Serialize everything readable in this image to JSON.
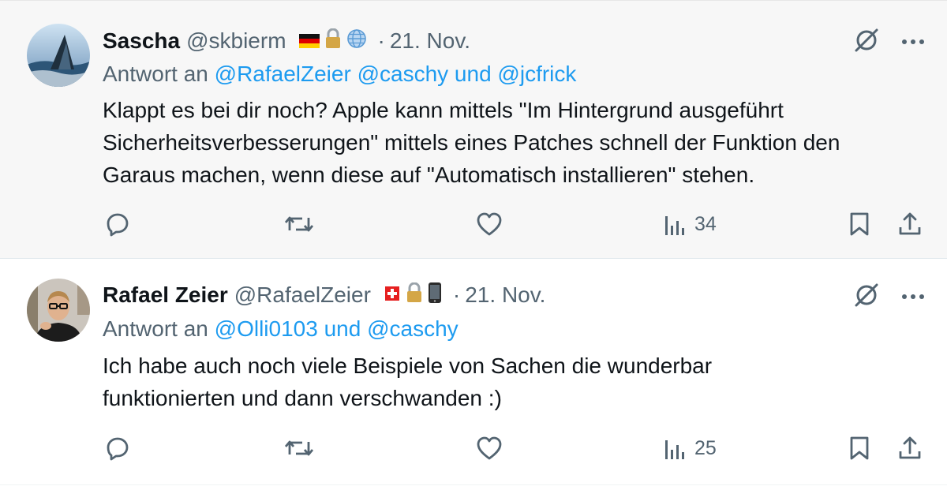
{
  "colors": {
    "link": "#1d9bf0",
    "secondary_text": "#536471",
    "primary_text": "#0f1419",
    "highlight_bg": "#f7f7f7"
  },
  "tweets": [
    {
      "name": "Sascha",
      "handle": "@skbierm",
      "badges": [
        "german-flag-icon",
        "lock-icon",
        "globe-icon"
      ],
      "separator": "·",
      "date": "21. Nov.",
      "reply_prefix": "Antwort an",
      "reply_mentions": "@RafaelZeier @caschy und @jcfrick",
      "body_lines": [
        "Klappt es bei dir noch? Apple kann mittels \"Im Hintergrund ausgeführt",
        "Sicherheitsverbesserungen\" mittels eines Patches schnell der Funktion den",
        "Garaus machen, wenn diese auf \"Automatisch installieren\" stehen."
      ],
      "views": "34"
    },
    {
      "name": "Rafael Zeier",
      "handle": "@RafaelZeier",
      "badges": [
        "swiss-flag-icon",
        "lock-icon",
        "mobile-phone-icon"
      ],
      "separator": "·",
      "date": "21. Nov.",
      "reply_prefix": "Antwort an",
      "reply_mentions": "@Olli0103 und @caschy",
      "body_lines": [
        "Ich habe auch noch viele Beispiele von Sachen die wunderbar",
        "funktionierten und dann verschwanden :)"
      ],
      "views": "25"
    }
  ]
}
